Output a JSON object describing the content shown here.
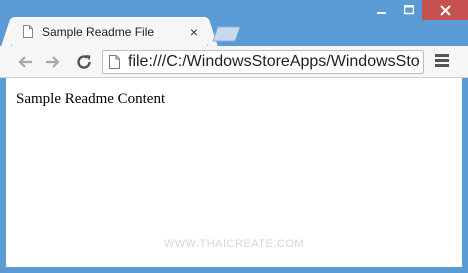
{
  "tab": {
    "title": "Sample Readme File",
    "close_glyph": "×"
  },
  "window": {
    "minimize_glyph": "▁",
    "close_glyph": "✕"
  },
  "toolbar": {
    "url": "file:///C:/WindowsStoreApps/WindowsSto"
  },
  "page": {
    "content": "Sample Readme Content"
  },
  "watermark": {
    "text": "WWW.THAICREATE.COM"
  },
  "icons": {
    "tab_icon": "document-icon",
    "back": "back-arrow-icon",
    "forward": "forward-arrow-icon",
    "reload": "reload-icon",
    "omnibox": "document-icon",
    "menu": "hamburger-menu-icon"
  },
  "colors": {
    "frame": "#5b9bd5",
    "close_button": "#c75050",
    "toolbar": "#f6f6f6"
  }
}
